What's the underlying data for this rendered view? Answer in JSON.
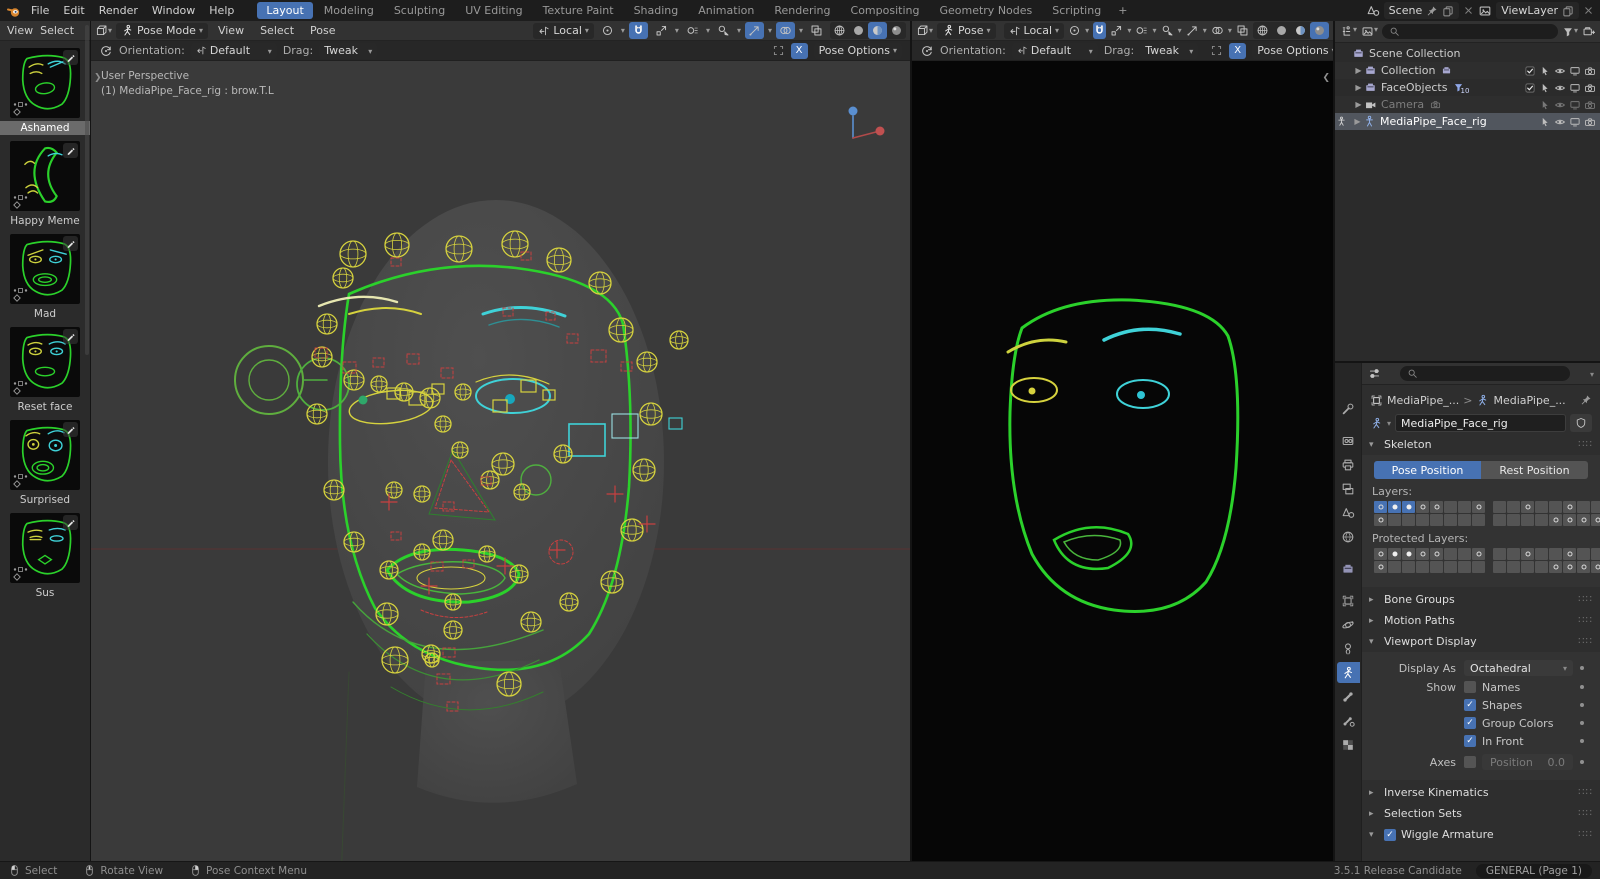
{
  "topbar": {
    "menus": [
      "File",
      "Edit",
      "Render",
      "Window",
      "Help"
    ],
    "workspaces": [
      "Layout",
      "Modeling",
      "Sculpting",
      "UV Editing",
      "Texture Paint",
      "Shading",
      "Animation",
      "Rendering",
      "Compositing",
      "Geometry Nodes",
      "Scripting"
    ],
    "active_workspace": "Layout",
    "add_workspace": "+",
    "scene_name": "Scene",
    "viewlayer_name": "ViewLayer"
  },
  "pose_library": {
    "menus": [
      "View",
      "Select"
    ],
    "items": [
      {
        "label": "Ashamed",
        "variant": "ashamed",
        "selected": true
      },
      {
        "label": "Happy Meme",
        "variant": "happy",
        "selected": false
      },
      {
        "label": "Mad",
        "variant": "mad",
        "selected": false
      },
      {
        "label": "Reset face",
        "variant": "reset",
        "selected": false
      },
      {
        "label": "Surprised",
        "variant": "surprised",
        "selected": false
      },
      {
        "label": "Sus",
        "variant": "sus",
        "selected": false
      }
    ]
  },
  "viewport_main": {
    "mode": "Pose Mode",
    "menus": [
      "View",
      "Select",
      "Pose"
    ],
    "orientation": "Local",
    "right_icons": [
      {
        "name": "visibility",
        "on": false
      },
      {
        "name": "gizmo",
        "on": true
      },
      {
        "name": "overlays",
        "on": true
      },
      {
        "name": "xray",
        "on": false
      }
    ],
    "shading_modes": [
      "wireframe",
      "solid",
      "material",
      "rendered"
    ],
    "shading_active": "material",
    "tool_row": {
      "orientation_label": "Orientation:",
      "orientation_value": "Default",
      "drag_label": "Drag:",
      "drag_value": "Tweak",
      "axis_toggle": "X",
      "pose_options": "Pose Options"
    },
    "overlay_lines": [
      "User Perspective",
      "(1) MediaPipe_Face_rig : brow.T.L"
    ]
  },
  "viewport_right": {
    "mode": "Pose",
    "orientation": "Local",
    "right_icons": [
      {
        "name": "visibility",
        "on": false
      },
      {
        "name": "gizmo",
        "on": false
      },
      {
        "name": "overlays",
        "on": false
      },
      {
        "name": "xray",
        "on": false
      }
    ],
    "shading_modes": [
      "wireframe",
      "solid",
      "material",
      "rendered"
    ],
    "shading_active": "rendered",
    "tool_row": {
      "orientation_label": "Orientation:",
      "orientation_value": "Default",
      "drag_label": "Drag:",
      "drag_value": "Tweak",
      "axis_toggle": "X",
      "pose_options": "Pose Options"
    }
  },
  "outliner": {
    "rows": [
      {
        "label": "Scene Collection",
        "icon": "collection",
        "depth": 0,
        "expand": false,
        "toggles": [],
        "selected": false,
        "dimmed": false
      },
      {
        "label": "Collection",
        "icon": "collection",
        "depth": 1,
        "expand": true,
        "extra_icon": "collection",
        "toggles": [
          "checkbox",
          "cursor",
          "eye",
          "screen",
          "camera"
        ],
        "selected": false,
        "dimmed": false
      },
      {
        "label": "FaceObjects",
        "icon": "collection",
        "depth": 1,
        "expand": true,
        "extra_icon": "funnel",
        "badge": "10",
        "toggles": [
          "checkbox",
          "cursor",
          "eye",
          "screen",
          "camera"
        ],
        "selected": false,
        "dimmed": false
      },
      {
        "label": "Camera",
        "icon": "camera-data",
        "depth": 1,
        "expand": true,
        "extra_icon": "camera-badge",
        "toggles": [
          "cursor",
          "eye",
          "screen",
          "camera"
        ],
        "selected": false,
        "dimmed": true
      },
      {
        "label": "MediaPipe_Face_rig",
        "icon": "armature",
        "depth": 1,
        "expand": true,
        "mode_icon": "pose-man",
        "toggles": [
          "cursor",
          "eye",
          "screen",
          "camera"
        ],
        "selected": true,
        "dimmed": false
      }
    ]
  },
  "properties": {
    "tabs": [
      "tool",
      "render",
      "output",
      "view-layer",
      "scene",
      "world",
      "collection",
      "object",
      "physics",
      "constraints",
      "object-data",
      "bone",
      "bone-constraint",
      "texture"
    ],
    "active_tab": "object-data",
    "tab_groups_after": [
      "tool",
      "world",
      "collection"
    ],
    "breadcrumb": {
      "object": "MediaPipe_...",
      "separator": ">",
      "data": "MediaPipe_..."
    },
    "datablock_name": "MediaPipe_Face_rig",
    "skeleton": {
      "title": "Skeleton",
      "pose_position": "Pose Position",
      "rest_position": "Rest Position",
      "layers_label": "Layers:",
      "protected_label": "Protected Layers:",
      "layers": [
        [
          "aR",
          "aF",
          "aF",
          "R",
          "R",
          "",
          "",
          "R"
        ],
        [
          "R",
          "",
          "",
          "",
          "",
          "",
          "",
          ""
        ],
        [
          "",
          "",
          "R",
          "",
          "",
          "R",
          "",
          ""
        ],
        [
          "",
          "",
          "",
          "",
          "R",
          "R",
          "R",
          "R"
        ]
      ],
      "protected_layers": [
        [
          "R",
          "F",
          "F",
          "R",
          "R",
          "",
          "",
          "R"
        ],
        [
          "R",
          "",
          "",
          "",
          "",
          "",
          "",
          ""
        ],
        [
          "",
          "",
          "R",
          "",
          "",
          "R",
          "",
          ""
        ],
        [
          "",
          "",
          "",
          "",
          "R",
          "R",
          "R",
          "R"
        ]
      ]
    },
    "collapsed_panels_top": [
      "Bone Groups",
      "Motion Paths"
    ],
    "viewport_display": {
      "title": "Viewport Display",
      "display_as_label": "Display As",
      "display_as_value": "Octahedral",
      "show_label": "Show",
      "show_items": [
        {
          "label": "Names",
          "checked": false
        },
        {
          "label": "Shapes",
          "checked": true
        },
        {
          "label": "Group Colors",
          "checked": true
        },
        {
          "label": "In Front",
          "checked": true
        }
      ],
      "axes_label": "Axes",
      "axes_checked": false,
      "position_label": "Position",
      "position_value": "0.0"
    },
    "collapsed_panels_bottom": [
      "Inverse Kinematics",
      "Selection Sets"
    ],
    "wiggle_panel": {
      "label": "Wiggle Armature",
      "checked": true
    }
  },
  "statusbar": {
    "items": [
      {
        "icon": "mouse-left",
        "label": "Select"
      },
      {
        "icon": "mouse-middle",
        "label": "Rotate View"
      },
      {
        "icon": "mouse-right",
        "label": "Pose Context Menu"
      }
    ],
    "version": "3.5.1 Release Candidate",
    "badge": "GENERAL (Page 1)"
  },
  "colors": {
    "accent": "#4772b3",
    "rig_green": "#2bd12b",
    "rig_yellow": "#d6d23e",
    "rig_cyan": "#3fd2d8",
    "rig_red": "#c84040"
  }
}
